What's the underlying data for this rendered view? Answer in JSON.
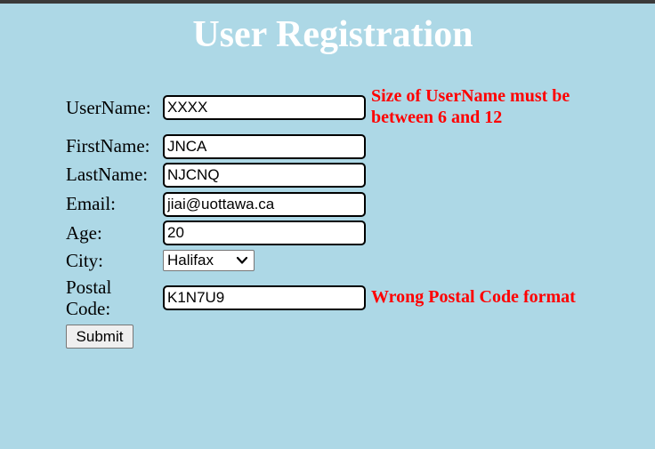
{
  "page": {
    "title": "User Registration"
  },
  "form": {
    "username": {
      "label": "UserName:",
      "value": "XXXX"
    },
    "firstname": {
      "label": "FirstName:",
      "value": "JNCA"
    },
    "lastname": {
      "label": "LastName:",
      "value": "NJCNQ"
    },
    "email": {
      "label": "Email:",
      "value": "jiai@uottawa.ca"
    },
    "age": {
      "label": "Age:",
      "value": "20"
    },
    "city": {
      "label": "City:",
      "selected": "Halifax",
      "icon": "chevron-down-icon"
    },
    "postal": {
      "label_line1": "Postal",
      "label_line2": "Code:",
      "value": "K1N7U9"
    },
    "submit_label": "Submit"
  },
  "errors": {
    "username_line1": "Size of UserName must be",
    "username_line2": "between 6 and 12",
    "postal": "Wrong Postal Code format"
  },
  "colors": {
    "background": "#add8e6",
    "title": "#ffffff",
    "error": "#ff0000"
  }
}
